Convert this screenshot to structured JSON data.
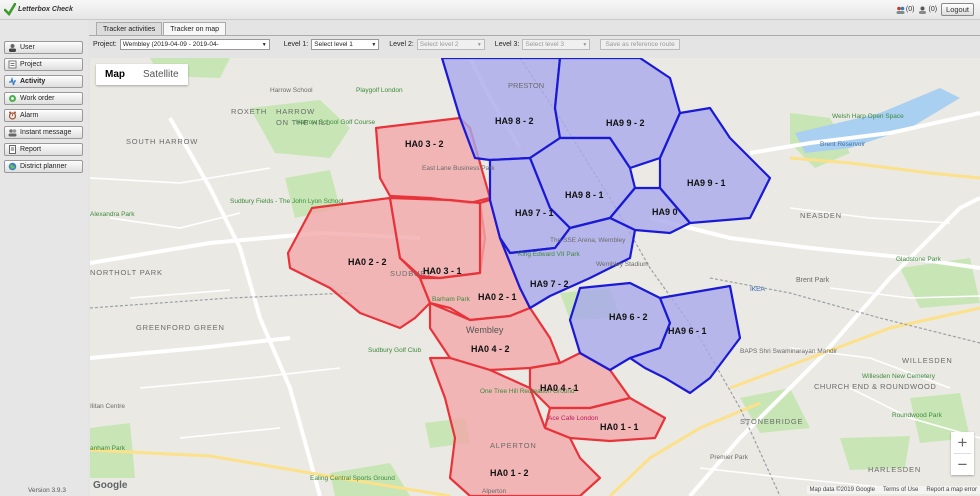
{
  "app": {
    "title": "Letterbox Check"
  },
  "topbar": {
    "notif1": "(0)",
    "notif2": "(0)",
    "logout_label": "Logout"
  },
  "sidebar": {
    "items": [
      {
        "label": "User",
        "icon": "user-icon"
      },
      {
        "label": "Project",
        "icon": "project-icon"
      },
      {
        "label": "Activity",
        "icon": "activity-icon",
        "active": true
      },
      {
        "label": "Work order",
        "icon": "work-order-icon"
      },
      {
        "label": "Alarm",
        "icon": "alarm-icon"
      },
      {
        "label": "Instant message",
        "icon": "message-icon"
      },
      {
        "label": "Report",
        "icon": "report-icon"
      },
      {
        "label": "District planner",
        "icon": "district-icon"
      }
    ],
    "version": "Version 3.9.3"
  },
  "tabs": [
    {
      "label": "Tracker activities"
    },
    {
      "label": "Tracker on map",
      "active": true
    }
  ],
  "filters": {
    "project_label": "Project:",
    "project_value": "Wembley (2019-04-09 - 2019-04-",
    "level1_label": "Level 1:",
    "level1_value": "Select level 1",
    "level2_label": "Level 2:",
    "level2_value": "Select level 2",
    "level3_label": "Level 3:",
    "level3_value": "Select level 3",
    "save_reference_label": "Save as reference route"
  },
  "map": {
    "type_map": "Map",
    "type_satellite": "Satellite",
    "zoom_in": "+",
    "zoom_out": "−",
    "google": "Google",
    "attribution": {
      "data": "Map data ©2019 Google",
      "terms": "Terms of Use",
      "report": "Report a map error"
    },
    "colors": {
      "red_zone": "#e8333a",
      "red_fill": "#f2a6a8",
      "blue_zone": "#1a1ad6",
      "blue_fill": "#a9a9ec"
    },
    "zones_red": [
      "HA0 3 - 2",
      "HA0 2 - 2",
      "HA0 3 - 1",
      "HA0 2 - 1",
      "HA0 4 - 2",
      "HA0 4 - 1",
      "HA0 1 - 1",
      "HA0 1 - 2"
    ],
    "zones_blue": [
      "HA9 8 - 2",
      "HA9 9 - 2",
      "HA9 8 - 1",
      "HA9 9 - 1",
      "HA9 7 - 1",
      "HA9 0",
      "HA9 7 - 2",
      "HA9 6 - 2",
      "HA9 6 - 1"
    ],
    "place_labels": [
      "PRESTON",
      "ROXETH",
      "HARROW",
      "ON THE HILL",
      "Harrow School",
      "Playgolf London",
      "Harrow School Golf Course",
      "SOUTH HARROW",
      "Welsh Harp Open Space",
      "Brent Reservoir",
      "NEASDEN",
      "East Lane Business Park",
      "Sudbury Fields - The John Lyon School",
      "Alexandra Park",
      "NORTHOLT PARK",
      "SUDBURY",
      "Barham Park",
      "Wembley",
      "Wembley Stadium",
      "The SSE Arena, Wembley",
      "King Edward VII Park",
      "Gladstone Park",
      "IKEA",
      "Brent Park",
      "GREENFORD GREEN",
      "Sudbury Golf Club",
      "One Tree Hill Recreation Ground",
      "Ace Cafe London",
      "WILLESDEN",
      "Willesden New Cemetery",
      "CHURCH END & ROUNDWOOD",
      "Roundwood Park",
      "BAPS Shri Swaminarayan Mandir",
      "STONEBRIDGE",
      "ALPERTON",
      "Premier Park",
      "HARLESDEN",
      "Ealing Central Sports Ground",
      "Ilitan Centre",
      "anham Park",
      "Alperton"
    ]
  }
}
